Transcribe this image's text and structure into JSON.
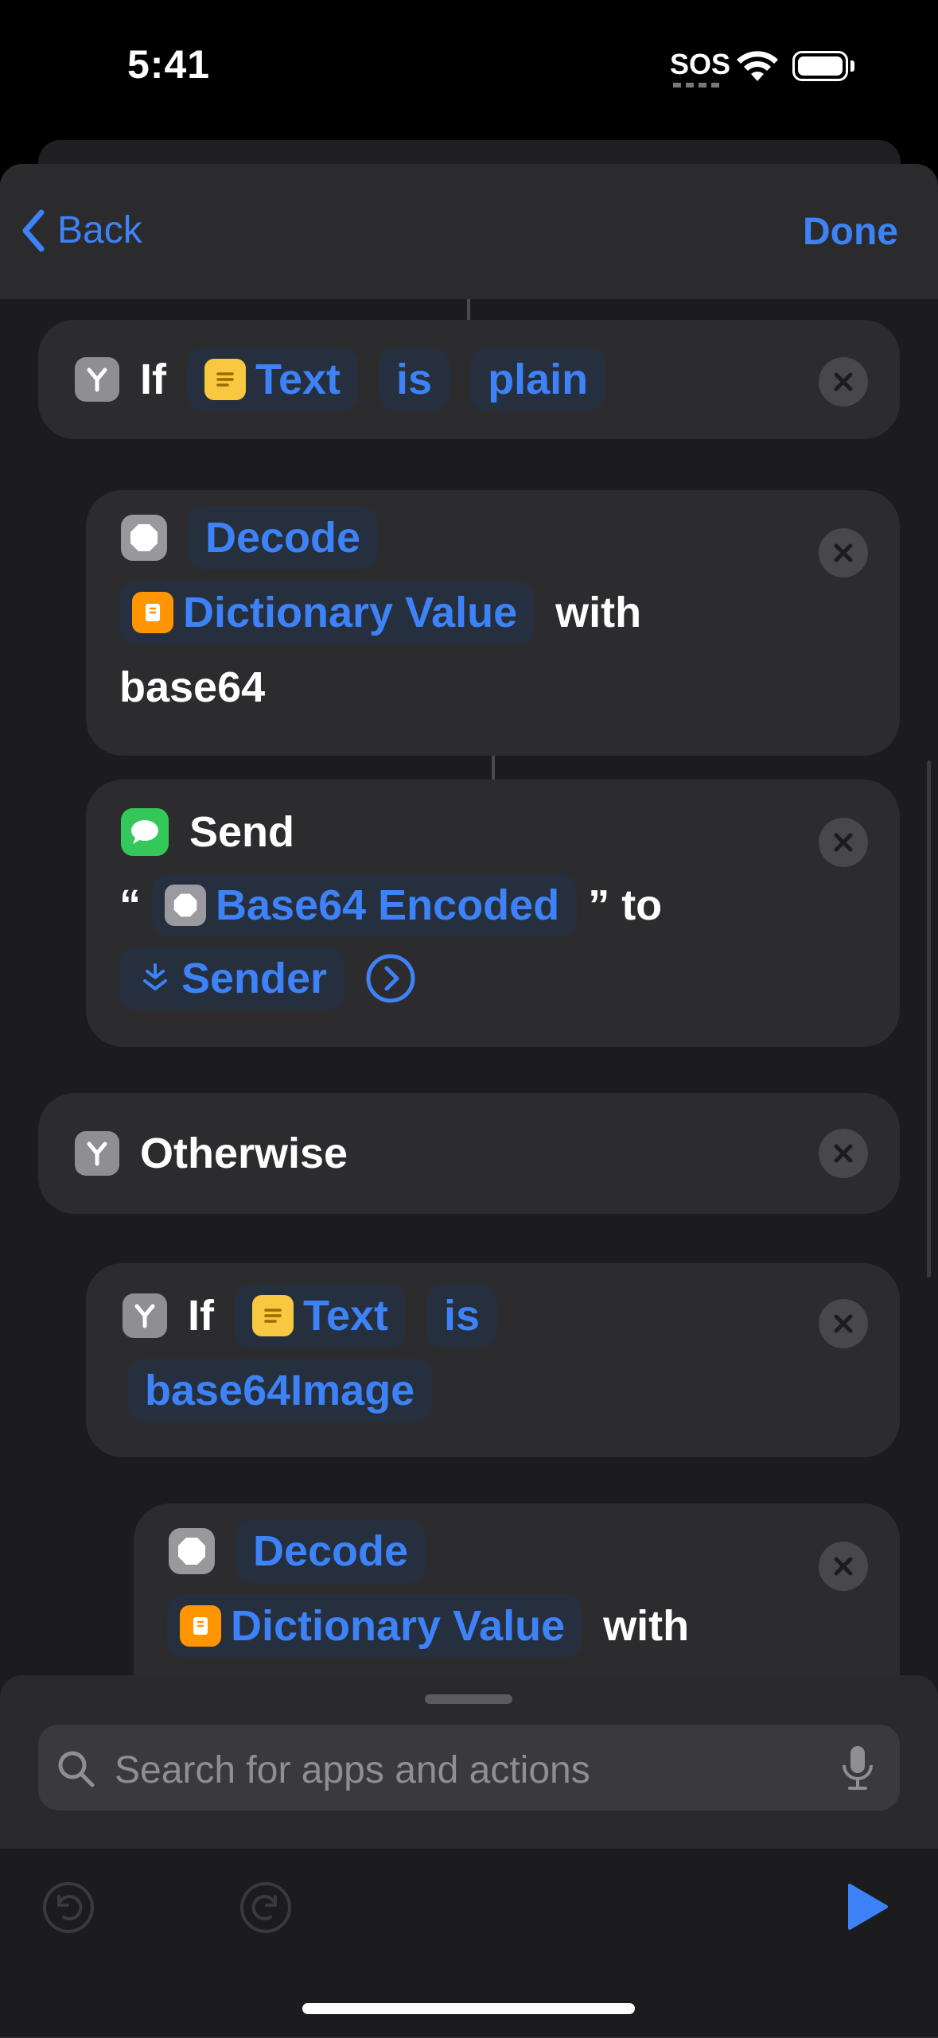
{
  "status_bar": {
    "time": "5:41",
    "sos": "SOS"
  },
  "nav": {
    "back_label": "Back",
    "done_label": "Done"
  },
  "actions": {
    "if1": {
      "keyword": "If",
      "variable": "Text",
      "operator": "is",
      "value": "plain"
    },
    "decode1": {
      "action": "Decode",
      "input": "Dictionary Value",
      "with_word": "with",
      "format": "base64"
    },
    "send": {
      "action": "Send",
      "open_quote": "“",
      "variable": "Base64 Encoded",
      "close_to": "” to",
      "recipient": "Sender"
    },
    "otherwise": {
      "label": "Otherwise"
    },
    "if2": {
      "keyword": "If",
      "variable": "Text",
      "operator": "is",
      "value": "base64Image"
    },
    "decode2": {
      "action": "Decode",
      "input": "Dictionary Value",
      "with_word": "with"
    }
  },
  "search": {
    "placeholder": "Search for apps and actions"
  },
  "colors": {
    "accent": "#3e82f7",
    "card": "#2c2c2e",
    "background": "#1c1c1e"
  },
  "icons": [
    "chevron-left-icon",
    "if-branch-icon",
    "text-icon",
    "stop-icon",
    "dictionary-icon",
    "messages-icon",
    "contact-icon",
    "chevron-right-circle-icon",
    "close-icon",
    "search-icon",
    "microphone-icon",
    "undo-icon",
    "redo-icon",
    "play-icon"
  ]
}
